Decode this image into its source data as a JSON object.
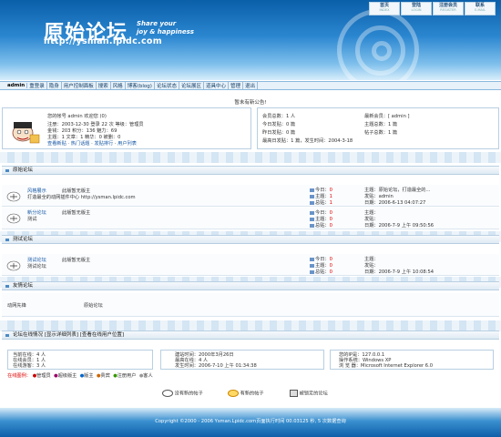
{
  "topnav": [
    {
      "label": "首页",
      "sub": "INDEX"
    },
    {
      "label": "登陆",
      "sub": "LOGIN"
    },
    {
      "label": "注册会员",
      "sub": "REGISTER"
    },
    {
      "label": "联系",
      "sub": "E-MAIL"
    }
  ],
  "logo": {
    "name": "原始论坛",
    "slogan_line1": "Share your",
    "slogan_line2": "joy & happiness",
    "url": "http://ysman.lpidc.com"
  },
  "menu": {
    "user": "admin",
    "items": [
      "退出",
      "隐身",
      "用户控制面板",
      "搜索",
      "风格",
      "博客(blog)",
      "论坛状态",
      "论坛展区",
      "道具中心",
      "管理",
      "退出"
    ],
    "first_item": "重登录"
  },
  "announcement": "暂未有新公告!",
  "userinfo": {
    "line1": "您的帐号 admin 欢迎您 (0)",
    "line2": "注册：2003-12-30 登录 22 次 等级：管理员",
    "line3": "金钱：203 积分：136 魅力：69",
    "line4": "主题：1 文章：1 精华：0 被删：0",
    "links": [
      "查看新贴",
      "热门话题",
      "发贴排行",
      "用户列表"
    ]
  },
  "stats": {
    "online_label": "会员总数：1 人",
    "newest_label": "最新会员：[ admin ]",
    "today_label": "今日发贴：0 篇",
    "topics_label": "主题总数：1 篇",
    "yesterday_label": "昨日发贴：0 篇",
    "posts_label": "帖子总数：1 篇",
    "max_label": "最高日发贴：1 篇，发生时间：2004-3-18"
  },
  "sections": {
    "main": "原始论坛",
    "test": "测试论坛",
    "friends": "友情论坛",
    "online": "论坛在线情况 [显示详细列表] [查看在线用户位置]"
  },
  "forums": [
    {
      "name": "风格展示",
      "moderator": "此版暂无版主",
      "desc": "打造最全的动网插件中心 http://ysman.lpidc.com",
      "today": "0",
      "topics": "1",
      "posts": "1",
      "last_title": "主题：原始论坛，打造最全的...",
      "last_user": "发贴：admin",
      "last_date": "日期：2006-6-13 04:07:27"
    },
    {
      "name": "新分论坛",
      "moderator": "此版暂无版主",
      "desc": "测试",
      "today": "0",
      "topics": "0",
      "posts": "0",
      "last_title": "主题：",
      "last_user": "发贴：",
      "last_date": "日期：2006-7-9 上午 09:50:56"
    },
    {
      "name": "测试论坛",
      "moderator": "此版暂无版主",
      "desc": "测试论坛",
      "today": "0",
      "topics": "0",
      "posts": "0",
      "last_title": "主题：",
      "last_user": "发贴：",
      "last_date": "日期：2006-7-9 上午 10:08:54"
    }
  ],
  "forum_labels": {
    "today": "今日：",
    "topics": "主题：",
    "posts": "总贴："
  },
  "friends": {
    "col1": "动网先锋",
    "col2": "原始论坛"
  },
  "online": {
    "current": "当前在线：4 人",
    "members": "在线会员：1 人",
    "guests": "在线游客：3 人",
    "built": "建站时间：2000年3月26日",
    "maxonline": "最高在线：4 人",
    "when": "发生时间：2006-7-10 上午 01:34:38",
    "ip": "您的IP是：127.0.0.1",
    "os": "操作系统：Windows XP",
    "browser": "浏 览 器：Microsoft Internet Explorer 6.0",
    "legend_title": "在线图例：",
    "legend": [
      "管理员",
      "超级版主",
      "版主",
      "贵宾",
      "注册用户",
      "客人"
    ]
  },
  "legend_bottom": [
    "没有新的帖子",
    "有新的帖子",
    "被锁定的论坛"
  ],
  "footer": "Copyright ©2000 - 2006 Ysman.Lpidc.com页面执行时间 00.03125 秒, 5 次数据查询",
  "colors": {
    "header_blue": "#1a73c1",
    "border": "#b8cfe2",
    "red": "#dd0000"
  }
}
